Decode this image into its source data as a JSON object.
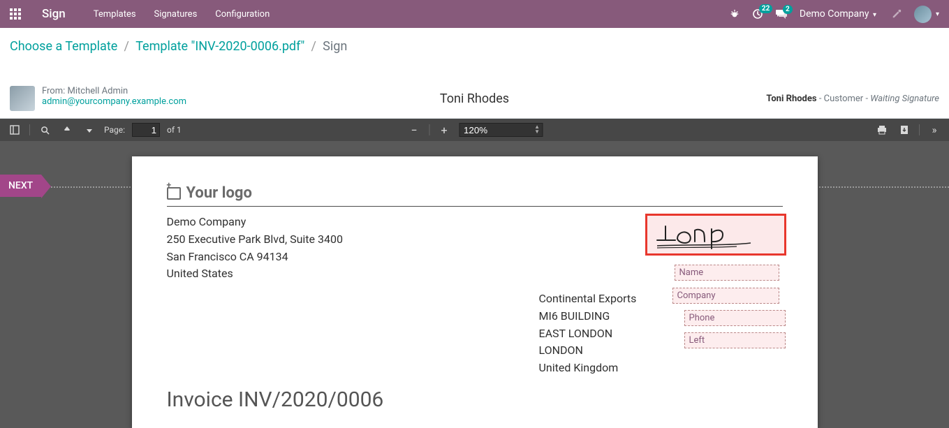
{
  "navbar": {
    "brand": "Sign",
    "links": [
      "Templates",
      "Signatures",
      "Configuration"
    ],
    "tasks_badge": "22",
    "discuss_badge": "2",
    "company": "Demo Company"
  },
  "breadcrumb": {
    "items": [
      "Choose a Template",
      "Template \"INV-2020-0006.pdf\""
    ],
    "current": "Sign"
  },
  "info": {
    "from_label": "From:",
    "from_name": "Mitchell Admin",
    "from_email": "admin@yourcompany.example.com",
    "signer_center": "Toni Rhodes",
    "status_name": "Toni Rhodes",
    "status_role": "Customer",
    "status_state": "Waiting Signature"
  },
  "pdf_toolbar": {
    "page_label": "Page:",
    "page_cur": "1",
    "page_of": "of 1",
    "zoom": "120%"
  },
  "next_label": "NEXT",
  "doc": {
    "logo_label": "Your logo",
    "company": {
      "name": "Demo Company",
      "line1": "250 Executive Park Blvd, Suite 3400",
      "line2": "San Francisco CA 94134",
      "country": "United States"
    },
    "customer": {
      "name": "Continental Exports",
      "line1": "MI6 BUILDING",
      "line2": "EAST LONDON",
      "city": "LONDON",
      "country": "United Kingdom"
    },
    "inv_title": "Invoice INV/2020/0006",
    "fields": {
      "name": "Name",
      "company": "Company",
      "phone": "Phone",
      "left": "Left"
    }
  }
}
